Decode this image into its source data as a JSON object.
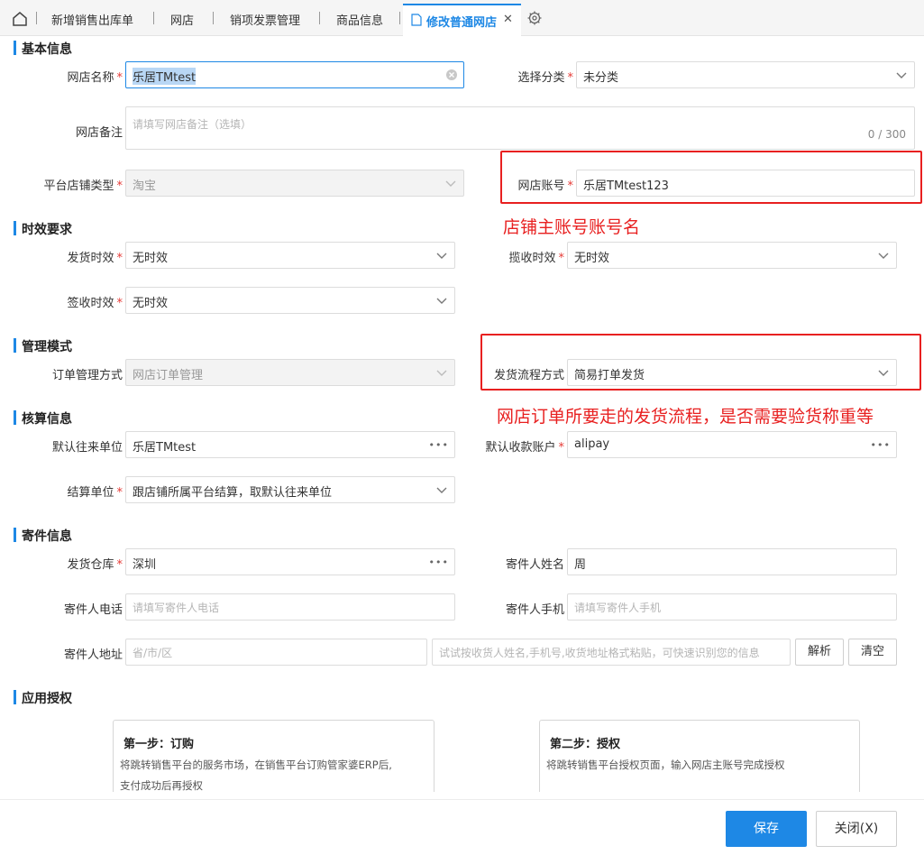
{
  "tabs": {
    "items": [
      "新增销售出库单",
      "网店",
      "销项发票管理",
      "商品信息"
    ],
    "active": "修改普通网店",
    "close_symbol": "✕"
  },
  "sections": {
    "basic": "基本信息",
    "timeliness": "时效要求",
    "management": "管理模式",
    "accounting": "核算信息",
    "shipping": "寄件信息",
    "auth": "应用授权"
  },
  "fields": {
    "shop_name": {
      "label": "网店名称",
      "value": "乐居TMtest"
    },
    "category": {
      "label": "选择分类",
      "value": "未分类"
    },
    "remark": {
      "label": "网店备注",
      "placeholder": "请填写网店备注（选填）",
      "counter": "0 / 300"
    },
    "platform_type": {
      "label": "平台店铺类型",
      "value": "淘宝"
    },
    "shop_account": {
      "label": "网店账号",
      "value": "乐居TMtest123"
    },
    "ship_time": {
      "label": "发货时效",
      "value": "无时效"
    },
    "pickup_time": {
      "label": "揽收时效",
      "value": "无时效"
    },
    "sign_time": {
      "label": "签收时效",
      "value": "无时效"
    },
    "order_mgmt": {
      "label": "订单管理方式",
      "value": "网店订单管理"
    },
    "ship_flow": {
      "label": "发货流程方式",
      "value": "简易打单发货"
    },
    "default_partner": {
      "label": "默认往来单位",
      "value": "乐居TMtest"
    },
    "default_account": {
      "label": "默认收款账户",
      "value": "alipay"
    },
    "settlement": {
      "label": "结算单位",
      "value": "跟店铺所属平台结算，取默认往来单位"
    },
    "warehouse": {
      "label": "发货仓库",
      "value": "深圳"
    },
    "sender_name": {
      "label": "寄件人姓名",
      "value": "周"
    },
    "sender_phone": {
      "label": "寄件人电话",
      "placeholder": "请填写寄件人电话"
    },
    "sender_mobile": {
      "label": "寄件人手机",
      "placeholder": "请填写寄件人手机"
    },
    "sender_address": {
      "label": "寄件人地址",
      "placeholder": "省/市/区",
      "smart_placeholder": "试试按收货人姓名,手机号,收货地址格式粘贴，可快速识别您的信息"
    }
  },
  "buttons": {
    "parse": "解析",
    "clear": "清空",
    "save": "保存",
    "close": "关闭(X)"
  },
  "annotations": {
    "shop_account_note": "店铺主账号账号名",
    "ship_flow_note": "网店订单所要走的发货流程，是否需要验货称重等"
  },
  "auth_cards": [
    {
      "title": "第一步：订购",
      "desc1": "将跳转销售平台的服务市场，在销售平台订购管家婆ERP后,",
      "desc2": "支付成功后再授权"
    },
    {
      "title": "第二步：授权",
      "desc1": "将跳转销售平台授权页面，输入网店主账号完成授权",
      "desc2": ""
    }
  ],
  "colors": {
    "accent": "#1e88e5",
    "annotation": "#e82020",
    "required": "#e53935"
  },
  "icons": [
    "home-icon",
    "document-icon",
    "close-icon",
    "gear-icon",
    "chevron-down-icon",
    "ellipsis-icon",
    "clear-icon"
  ]
}
